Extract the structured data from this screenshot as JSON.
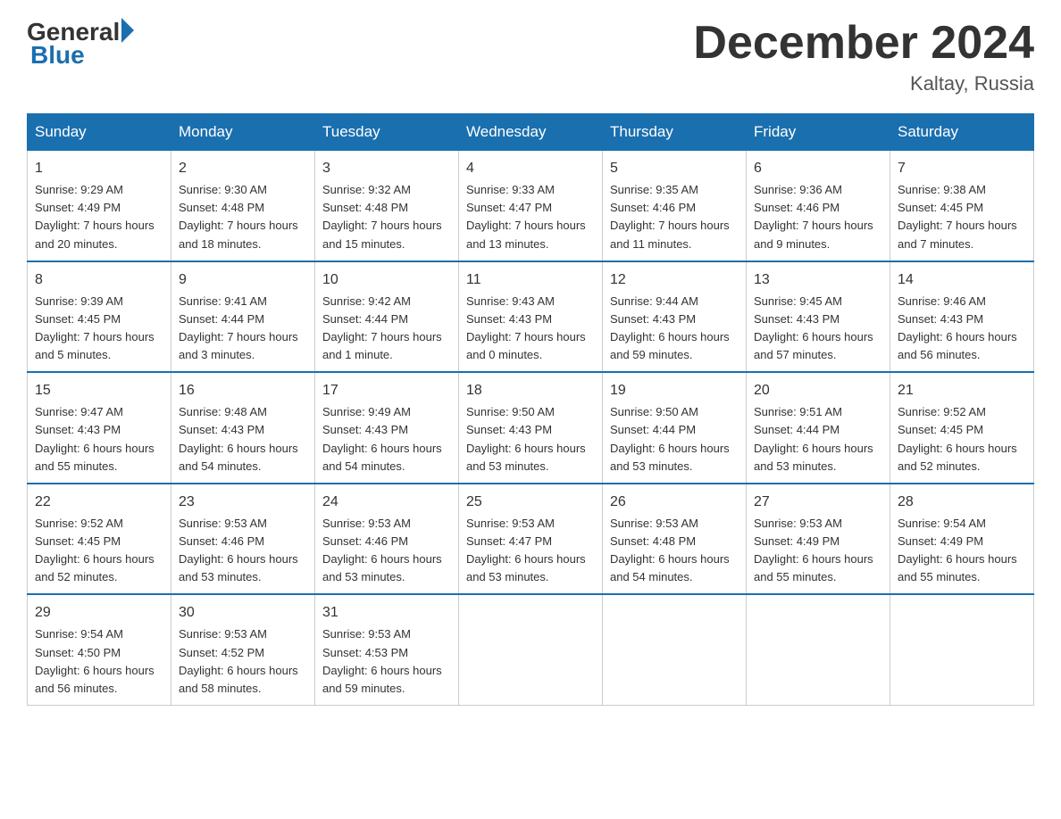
{
  "header": {
    "logo_general": "General",
    "logo_blue": "Blue",
    "month_title": "December 2024",
    "location": "Kaltay, Russia"
  },
  "days_of_week": [
    "Sunday",
    "Monday",
    "Tuesday",
    "Wednesday",
    "Thursday",
    "Friday",
    "Saturday"
  ],
  "weeks": [
    [
      {
        "day": "1",
        "sunrise": "9:29 AM",
        "sunset": "4:49 PM",
        "daylight": "7 hours and 20 minutes."
      },
      {
        "day": "2",
        "sunrise": "9:30 AM",
        "sunset": "4:48 PM",
        "daylight": "7 hours and 18 minutes."
      },
      {
        "day": "3",
        "sunrise": "9:32 AM",
        "sunset": "4:48 PM",
        "daylight": "7 hours and 15 minutes."
      },
      {
        "day": "4",
        "sunrise": "9:33 AM",
        "sunset": "4:47 PM",
        "daylight": "7 hours and 13 minutes."
      },
      {
        "day": "5",
        "sunrise": "9:35 AM",
        "sunset": "4:46 PM",
        "daylight": "7 hours and 11 minutes."
      },
      {
        "day": "6",
        "sunrise": "9:36 AM",
        "sunset": "4:46 PM",
        "daylight": "7 hours and 9 minutes."
      },
      {
        "day": "7",
        "sunrise": "9:38 AM",
        "sunset": "4:45 PM",
        "daylight": "7 hours and 7 minutes."
      }
    ],
    [
      {
        "day": "8",
        "sunrise": "9:39 AM",
        "sunset": "4:45 PM",
        "daylight": "7 hours and 5 minutes."
      },
      {
        "day": "9",
        "sunrise": "9:41 AM",
        "sunset": "4:44 PM",
        "daylight": "7 hours and 3 minutes."
      },
      {
        "day": "10",
        "sunrise": "9:42 AM",
        "sunset": "4:44 PM",
        "daylight": "7 hours and 1 minute."
      },
      {
        "day": "11",
        "sunrise": "9:43 AM",
        "sunset": "4:43 PM",
        "daylight": "7 hours and 0 minutes."
      },
      {
        "day": "12",
        "sunrise": "9:44 AM",
        "sunset": "4:43 PM",
        "daylight": "6 hours and 59 minutes."
      },
      {
        "day": "13",
        "sunrise": "9:45 AM",
        "sunset": "4:43 PM",
        "daylight": "6 hours and 57 minutes."
      },
      {
        "day": "14",
        "sunrise": "9:46 AM",
        "sunset": "4:43 PM",
        "daylight": "6 hours and 56 minutes."
      }
    ],
    [
      {
        "day": "15",
        "sunrise": "9:47 AM",
        "sunset": "4:43 PM",
        "daylight": "6 hours and 55 minutes."
      },
      {
        "day": "16",
        "sunrise": "9:48 AM",
        "sunset": "4:43 PM",
        "daylight": "6 hours and 54 minutes."
      },
      {
        "day": "17",
        "sunrise": "9:49 AM",
        "sunset": "4:43 PM",
        "daylight": "6 hours and 54 minutes."
      },
      {
        "day": "18",
        "sunrise": "9:50 AM",
        "sunset": "4:43 PM",
        "daylight": "6 hours and 53 minutes."
      },
      {
        "day": "19",
        "sunrise": "9:50 AM",
        "sunset": "4:44 PM",
        "daylight": "6 hours and 53 minutes."
      },
      {
        "day": "20",
        "sunrise": "9:51 AM",
        "sunset": "4:44 PM",
        "daylight": "6 hours and 53 minutes."
      },
      {
        "day": "21",
        "sunrise": "9:52 AM",
        "sunset": "4:45 PM",
        "daylight": "6 hours and 52 minutes."
      }
    ],
    [
      {
        "day": "22",
        "sunrise": "9:52 AM",
        "sunset": "4:45 PM",
        "daylight": "6 hours and 52 minutes."
      },
      {
        "day": "23",
        "sunrise": "9:53 AM",
        "sunset": "4:46 PM",
        "daylight": "6 hours and 53 minutes."
      },
      {
        "day": "24",
        "sunrise": "9:53 AM",
        "sunset": "4:46 PM",
        "daylight": "6 hours and 53 minutes."
      },
      {
        "day": "25",
        "sunrise": "9:53 AM",
        "sunset": "4:47 PM",
        "daylight": "6 hours and 53 minutes."
      },
      {
        "day": "26",
        "sunrise": "9:53 AM",
        "sunset": "4:48 PM",
        "daylight": "6 hours and 54 minutes."
      },
      {
        "day": "27",
        "sunrise": "9:53 AM",
        "sunset": "4:49 PM",
        "daylight": "6 hours and 55 minutes."
      },
      {
        "day": "28",
        "sunrise": "9:54 AM",
        "sunset": "4:49 PM",
        "daylight": "6 hours and 55 minutes."
      }
    ],
    [
      {
        "day": "29",
        "sunrise": "9:54 AM",
        "sunset": "4:50 PM",
        "daylight": "6 hours and 56 minutes."
      },
      {
        "day": "30",
        "sunrise": "9:53 AM",
        "sunset": "4:52 PM",
        "daylight": "6 hours and 58 minutes."
      },
      {
        "day": "31",
        "sunrise": "9:53 AM",
        "sunset": "4:53 PM",
        "daylight": "6 hours and 59 minutes."
      },
      null,
      null,
      null,
      null
    ]
  ],
  "labels": {
    "sunrise": "Sunrise:",
    "sunset": "Sunset:",
    "daylight": "Daylight:"
  }
}
